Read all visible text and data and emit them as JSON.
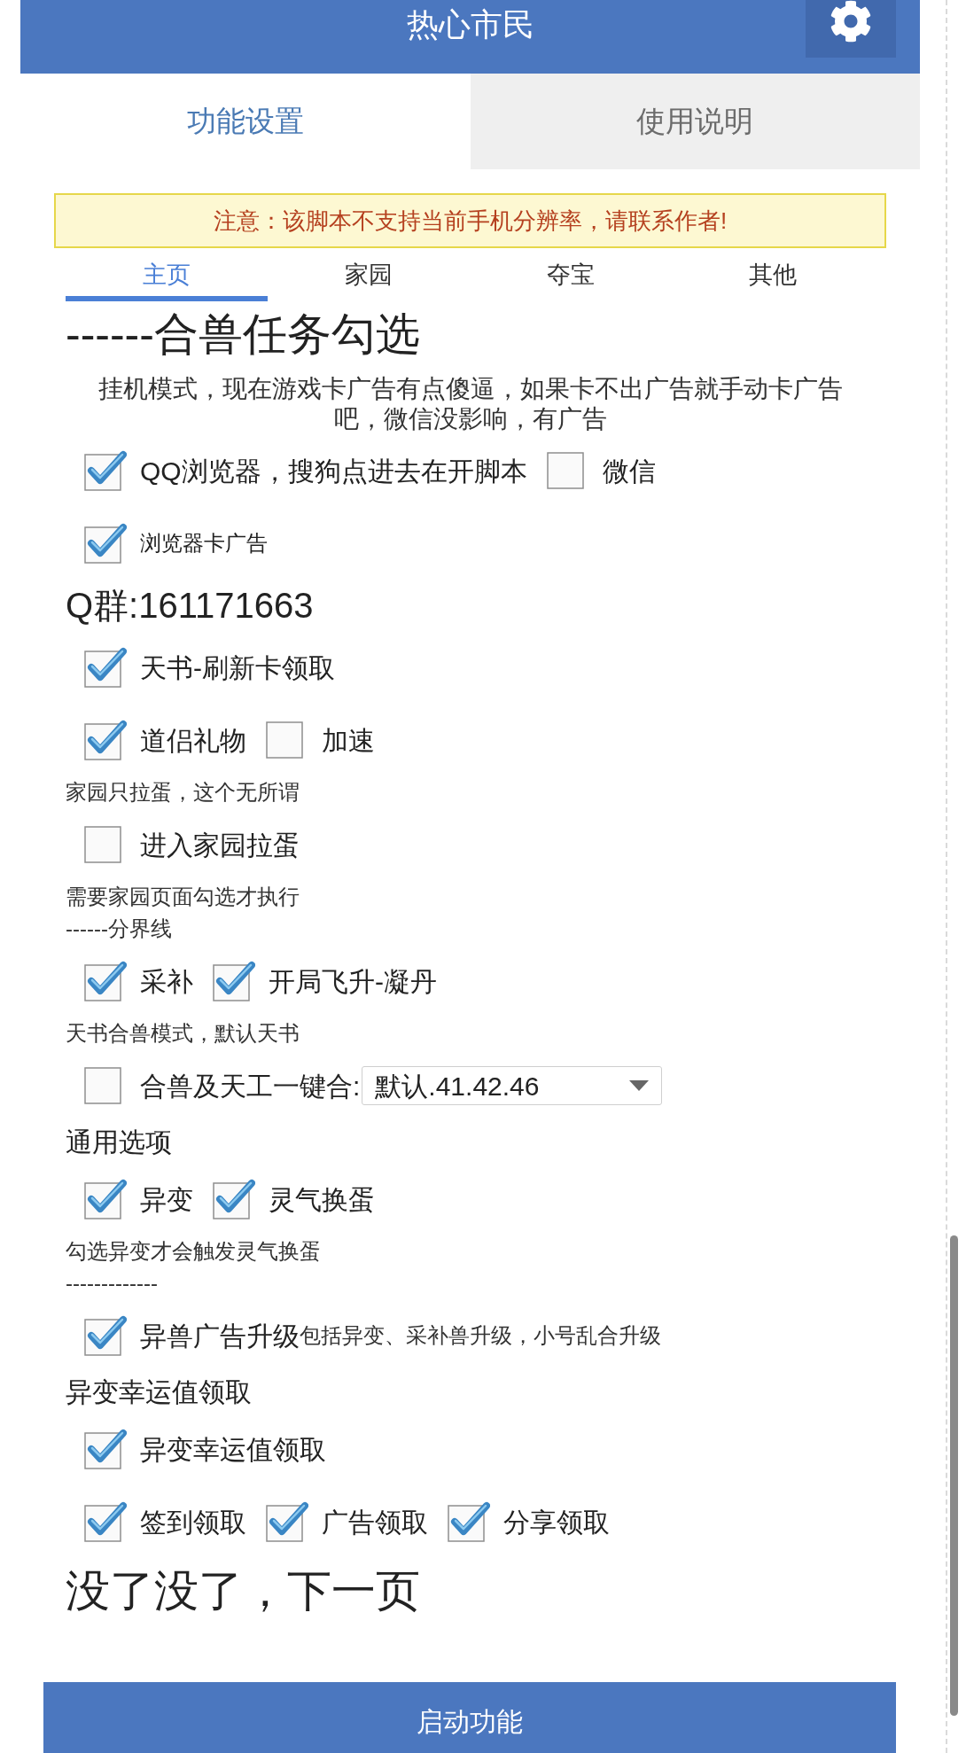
{
  "header": {
    "title": "热心市民"
  },
  "tabs": [
    {
      "label": "功能设置",
      "selected": true
    },
    {
      "label": "使用说明",
      "selected": false
    }
  ],
  "notice": "注意：该脚本不支持当前手机分辨率，请联系作者!",
  "sub_tabs": [
    {
      "label": "主页",
      "selected": true
    },
    {
      "label": "家园",
      "selected": false
    },
    {
      "label": "夺宝",
      "selected": false
    },
    {
      "label": "其他",
      "selected": false
    }
  ],
  "content": [
    {
      "kind": "title",
      "text": "------合兽任务勾选"
    },
    {
      "kind": "description",
      "text": "挂机模式，现在游戏卡广告有点傻逼，如果卡不出广告就手动卡广告吧，微信没影响，有广告"
    },
    {
      "kind": "checks",
      "options": [
        {
          "label": "QQ浏览器，搜狗点进去在开脚本",
          "checked": true
        },
        {
          "label": "微信",
          "checked": false
        }
      ]
    },
    {
      "kind": "checks_small",
      "options": [
        {
          "label": "浏览器卡广告",
          "checked": true
        }
      ]
    },
    {
      "kind": "subtitle",
      "text": "Q群:161171663"
    },
    {
      "kind": "checks",
      "options": [
        {
          "label": "天书-刷新卡领取",
          "checked": true
        }
      ]
    },
    {
      "kind": "checks",
      "options": [
        {
          "label": "道侣礼物",
          "checked": true
        },
        {
          "label": "加速",
          "checked": false
        }
      ]
    },
    {
      "kind": "hint",
      "text": "家园只拉蛋，这个无所谓"
    },
    {
      "kind": "checks",
      "options": [
        {
          "label": "进入家园拉蛋",
          "checked": false
        }
      ]
    },
    {
      "kind": "hint",
      "text": "需要家园页面勾选才执行"
    },
    {
      "kind": "hint",
      "text": "------分界线"
    },
    {
      "kind": "checks",
      "options": [
        {
          "label": "采补",
          "checked": true
        },
        {
          "label": "开局飞升-凝丹",
          "checked": true
        }
      ]
    },
    {
      "kind": "hint",
      "text": "天书合兽模式，默认天书"
    },
    {
      "kind": "check_select",
      "label": "合兽及天工一键合:",
      "checked": false,
      "value": "默认.41.42.46"
    },
    {
      "kind": "caption",
      "text": "通用选项"
    },
    {
      "kind": "checks",
      "options": [
        {
          "label": "异变",
          "checked": true
        },
        {
          "label": "灵气换蛋",
          "checked": true
        }
      ]
    },
    {
      "kind": "hint",
      "text": "勾选异变才会触发灵气换蛋"
    },
    {
      "kind": "hint",
      "text": "-------------"
    },
    {
      "kind": "checks",
      "options": [
        {
          "label": "异兽广告升级",
          "note": "包括异变、采补兽升级，小号乱合升级",
          "checked": true
        }
      ]
    },
    {
      "kind": "caption",
      "text": "异变幸运值领取"
    },
    {
      "kind": "checks",
      "options": [
        {
          "label": "异变幸运值领取",
          "checked": true
        }
      ]
    },
    {
      "kind": "checks",
      "options": [
        {
          "label": "签到领取",
          "checked": true
        },
        {
          "label": "广告领取",
          "checked": true
        },
        {
          "label": "分享领取",
          "checked": true
        }
      ]
    },
    {
      "kind": "title",
      "text": "没了没了，下一页"
    }
  ],
  "start_button": {
    "label": "启动功能"
  }
}
